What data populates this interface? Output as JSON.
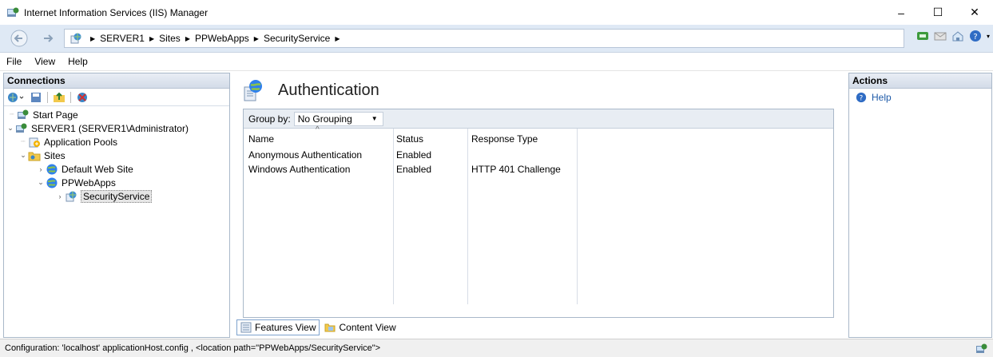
{
  "window": {
    "title": "Internet Information Services (IIS) Manager",
    "controls": {
      "minimize": "–",
      "maximize": "☐",
      "close": "✕"
    }
  },
  "address": {
    "crumbs": [
      "SERVER1",
      "Sites",
      "PPWebApps",
      "SecurityService"
    ]
  },
  "menu": [
    "File",
    "View",
    "Help"
  ],
  "connections": {
    "header": "Connections",
    "tree": [
      {
        "label": "Start Page",
        "icon": "start-page-icon",
        "expander": ""
      },
      {
        "label": "SERVER1 (SERVER1\\Administrator)",
        "icon": "server-icon",
        "expander": "⌄"
      },
      {
        "label": "Application Pools",
        "icon": "app-pools-icon",
        "expander": ""
      },
      {
        "label": "Sites",
        "icon": "sites-folder-icon",
        "expander": "⌄"
      },
      {
        "label": "Default Web Site",
        "icon": "globe-icon",
        "expander": "›"
      },
      {
        "label": "PPWebApps",
        "icon": "globe-icon",
        "expander": "⌄"
      },
      {
        "label": "SecurityService",
        "icon": "web-app-icon",
        "expander": "›"
      }
    ]
  },
  "feature": {
    "title": "Authentication",
    "group_by_label": "Group by:",
    "group_by_value": "No Grouping",
    "columns": [
      "Name",
      "Status",
      "Response Type"
    ],
    "rows": [
      {
        "name": "Anonymous Authentication",
        "status": "Enabled",
        "response": ""
      },
      {
        "name": "Windows Authentication",
        "status": "Enabled",
        "response": "HTTP 401 Challenge"
      }
    ],
    "tabs": [
      "Features View",
      "Content View"
    ]
  },
  "actions": {
    "header": "Actions",
    "items": [
      "Help"
    ]
  },
  "status": {
    "text": "Configuration: 'localhost' applicationHost.config , <location path=\"PPWebApps/SecurityService\">"
  }
}
